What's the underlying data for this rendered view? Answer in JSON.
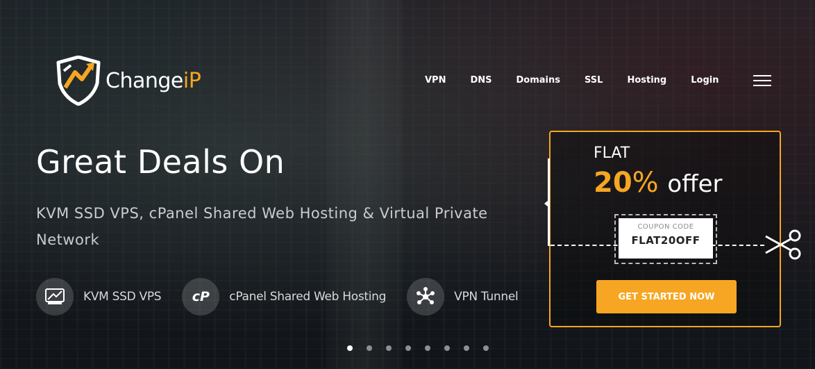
{
  "brand": {
    "name_prefix": "Change",
    "name_suffix": "iP",
    "accent_color": "#f6a623"
  },
  "nav": {
    "items": [
      "VPN",
      "DNS",
      "Domains",
      "SSL",
      "Hosting",
      "Login"
    ],
    "menu_icon": "hamburger-menu-icon"
  },
  "hero": {
    "headline": "Great Deals On",
    "subhead": "KVM SSD VPS, cPanel Shared Web Hosting & Virtual Private Network",
    "features": [
      {
        "label": "KVM SSD VPS",
        "icon": "vps-icon"
      },
      {
        "label": "cPanel Shared Web Hosting",
        "icon": "cpanel-icon"
      },
      {
        "label": "VPN Tunnel",
        "icon": "vpn-network-icon"
      }
    ],
    "slides": {
      "count": 8,
      "active_index": 0
    }
  },
  "offer": {
    "flat_label": "FLAT",
    "percent_value": "20",
    "percent_sign": "%",
    "offer_word": "offer",
    "coupon_label": "COUPON CODE",
    "coupon_code": "FLAT20OFF",
    "cta_label": "GET STARTED NOW",
    "scissors_icon": "scissors-icon"
  }
}
